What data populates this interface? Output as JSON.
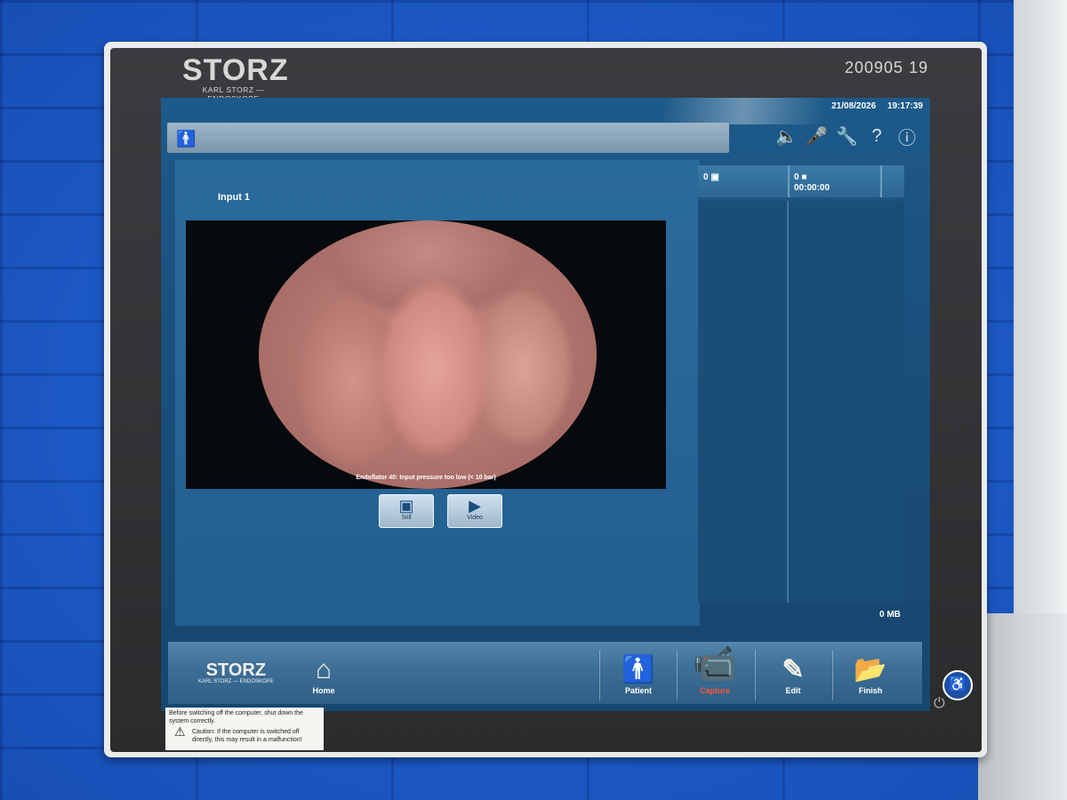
{
  "monitor": {
    "brand": "STORZ",
    "brand_sub": "KARL STORZ — ENDOSKOPE",
    "serial": "200905 19"
  },
  "screen": {
    "date": "21/08/2026",
    "time": "19:17:39",
    "top_icons": [
      "speaker-icon",
      "microphone-icon",
      "wrench-icon",
      "help-icon",
      "power-info-icon"
    ],
    "capture": {
      "input_label": "Input 1",
      "overlay_warning": "Endoflator 40: Input pressure too low (< 10 bar)",
      "buttons": {
        "still": "Still",
        "video": "Video"
      }
    },
    "thumbs": {
      "still_count": "0",
      "video_count": "0",
      "video_duration": "00:00:00",
      "storage": "0 MB"
    },
    "bottom_nav": {
      "logo": "STORZ",
      "logo_sub": "KARL STORZ — ENDOSKOPE",
      "home": "Home",
      "patient": "Patient",
      "capture": "Capture",
      "edit": "Edit",
      "finish": "Finish"
    }
  },
  "sticker": {
    "line1": "Before switching off the computer, shut down the system correctly.",
    "caution": "Caution: If the computer is switched off directly, this may result in a malfunction!"
  },
  "colors": {
    "accent_capture": "#ff5533",
    "screen_bg": "#1a4f7c"
  }
}
